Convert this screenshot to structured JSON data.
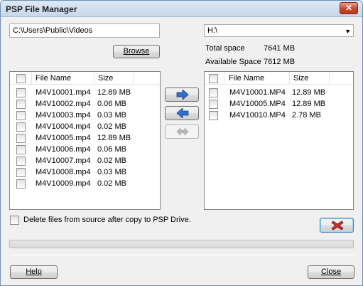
{
  "window": {
    "title": "PSP File Manager"
  },
  "source": {
    "path": "C:\\Users\\Public\\Videos",
    "browse_label": "Browse",
    "columns": {
      "name": "File Name",
      "size": "Size"
    },
    "files": [
      {
        "name": "M4V10001.mp4",
        "size": "12.89 MB"
      },
      {
        "name": "M4V10002.mp4",
        "size": "0.06 MB"
      },
      {
        "name": "M4V10003.mp4",
        "size": "0.03 MB"
      },
      {
        "name": "M4V10004.mp4",
        "size": "0.02 MB"
      },
      {
        "name": "M4V10005.mp4",
        "size": "12.89 MB"
      },
      {
        "name": "M4V10006.mp4",
        "size": "0.06 MB"
      },
      {
        "name": "M4V10007.mp4",
        "size": "0.02 MB"
      },
      {
        "name": "M4V10008.mp4",
        "size": "0.03 MB"
      },
      {
        "name": "M4V10009.mp4",
        "size": "0.02 MB"
      }
    ],
    "delete_option": "Delete files from source after copy to PSP Drive."
  },
  "destination": {
    "drive": "H:\\",
    "total_space_label": "Total space",
    "total_space_value": "7641 MB",
    "available_space_label": "Available Space",
    "available_space_value": "7612 MB",
    "columns": {
      "name": "File Name",
      "size": "Size"
    },
    "files": [
      {
        "name": "M4V10001.MP4",
        "size": "12.89 MB"
      },
      {
        "name": "M4V10005.MP4",
        "size": "12.89 MB"
      },
      {
        "name": "M4V10010.MP4",
        "size": "2.78 MB"
      }
    ]
  },
  "transfer": {
    "copy_right_icon": "arrow-right-icon",
    "copy_left_icon": "arrow-left-icon",
    "sync_icon": "double-arrow-icon",
    "delete_icon": "delete-x-icon",
    "progress": 0
  },
  "footer": {
    "help_label": "Help",
    "close_label": "Close"
  }
}
